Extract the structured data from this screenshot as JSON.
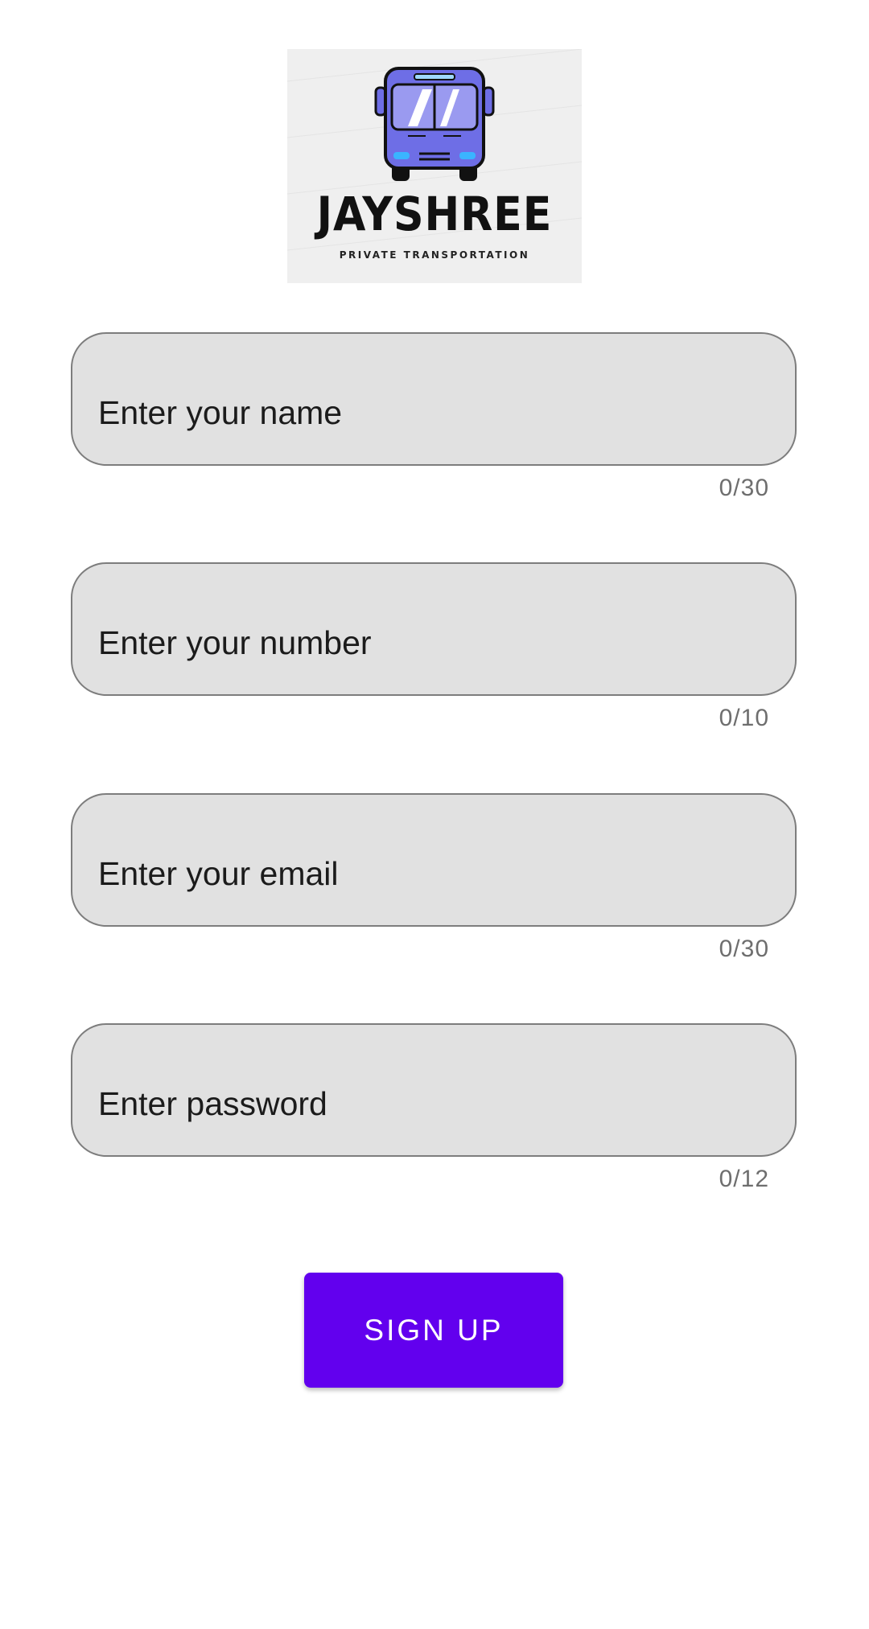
{
  "logo": {
    "name": "JAYSHREE",
    "tagline": "PRIVATE TRANSPORTATION",
    "icon": "bus-icon",
    "bus_color": "#6e6ee6",
    "background": "#efefef"
  },
  "form": {
    "fields": [
      {
        "placeholder": "Enter your name",
        "value": "",
        "counter": "0/30"
      },
      {
        "placeholder": "Enter your number",
        "value": "",
        "counter": "0/10"
      },
      {
        "placeholder": "Enter your email",
        "value": "",
        "counter": "0/30"
      },
      {
        "placeholder": "Enter password",
        "value": "",
        "counter": "0/12"
      }
    ],
    "field_background": "#e1e1e1",
    "field_border": "#7d7d7d"
  },
  "signup": {
    "label": "SIGN UP",
    "color": "#6200ee"
  }
}
